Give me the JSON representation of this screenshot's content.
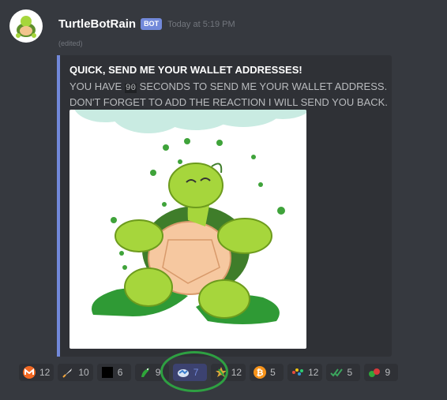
{
  "message": {
    "username": "TurtleBotRain",
    "bot_tag": "BOT",
    "timestamp": "Today at 5:19 PM",
    "edited": "(edited)"
  },
  "embed": {
    "accent_color": "#7289da",
    "title": "QUICK, SEND ME YOUR WALLET ADDRESSES!",
    "desc_pre": "YOU HAVE ",
    "desc_code": "90",
    "desc_post": " SECONDS TO SEND ME YOUR WALLET ADDRESS. DON'T FORGET TO ADD THE REACTION I WILL SEND YOU BACK."
  },
  "reactions": [
    {
      "icon": "monero-icon",
      "count": "12"
    },
    {
      "icon": "rocket-icon",
      "count": "10"
    },
    {
      "icon": "black-square-icon",
      "count": "6"
    },
    {
      "icon": "green-dragon-icon",
      "count": "9"
    },
    {
      "icon": "turtle-coin-icon",
      "count": "7",
      "active": true
    },
    {
      "icon": "gold-star-icon",
      "count": "12"
    },
    {
      "icon": "bitcoin-icon",
      "count": "5"
    },
    {
      "icon": "colorful-logo-icon",
      "count": "12"
    },
    {
      "icon": "double-check-icon",
      "count": "5"
    },
    {
      "icon": "green-red-icon",
      "count": "9"
    }
  ]
}
